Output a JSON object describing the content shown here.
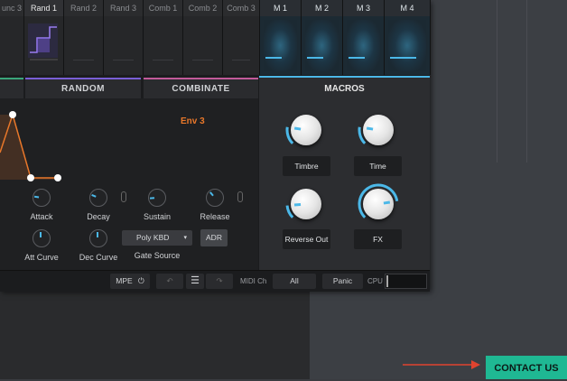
{
  "mod_tabs": [
    {
      "label": "unc 3",
      "active": false
    },
    {
      "label": "Rand 1",
      "active": true
    },
    {
      "label": "Rand 2",
      "active": false
    },
    {
      "label": "Rand 3",
      "active": false
    },
    {
      "label": "Comb 1",
      "active": false
    },
    {
      "label": "Comb 2",
      "active": false
    },
    {
      "label": "Comb 3",
      "active": false
    }
  ],
  "macro_tabs": [
    {
      "label": "M 1",
      "level": 0.55
    },
    {
      "label": "M 2",
      "level": 0.55
    },
    {
      "label": "M 3",
      "level": 0.55
    },
    {
      "label": "M 4",
      "level": 0.75
    }
  ],
  "sections": {
    "random": "RANDOM",
    "combinate": "COMBINATE",
    "macros": "MACROS"
  },
  "envelope": {
    "name": "Env 3",
    "name_color": "#e8772a",
    "knobs": [
      {
        "label": "Attack",
        "level": 0.2
      },
      {
        "label": "Decay",
        "level": 0.25
      },
      {
        "label": "Sustain",
        "level": 0.15
      },
      {
        "label": "Release",
        "level": 0.35
      }
    ],
    "curve_knobs": [
      {
        "label": "Att Curve"
      },
      {
        "label": "Dec Curve"
      }
    ],
    "gate_source_select": "Poly KBD",
    "gate_source_label": "Gate Source",
    "adr_button": "ADR"
  },
  "macros": {
    "knobs": [
      {
        "label": "Timbre",
        "level": 0.2
      },
      {
        "label": "Time",
        "level": 0.2
      },
      {
        "label": "Reverse Out",
        "level": 0.15
      },
      {
        "label": "FX",
        "level": 0.8
      }
    ],
    "accent": "#4bb8e8"
  },
  "bottombar": {
    "mpe_label": "MPE",
    "midi_ch_label": "MIDI Ch",
    "midi_ch_value": "All",
    "panic_label": "Panic",
    "cpu_label": "CPU"
  },
  "contact": {
    "label": "CONTACT US",
    "color": "#1fb893",
    "arrow_color": "#e0432f"
  }
}
